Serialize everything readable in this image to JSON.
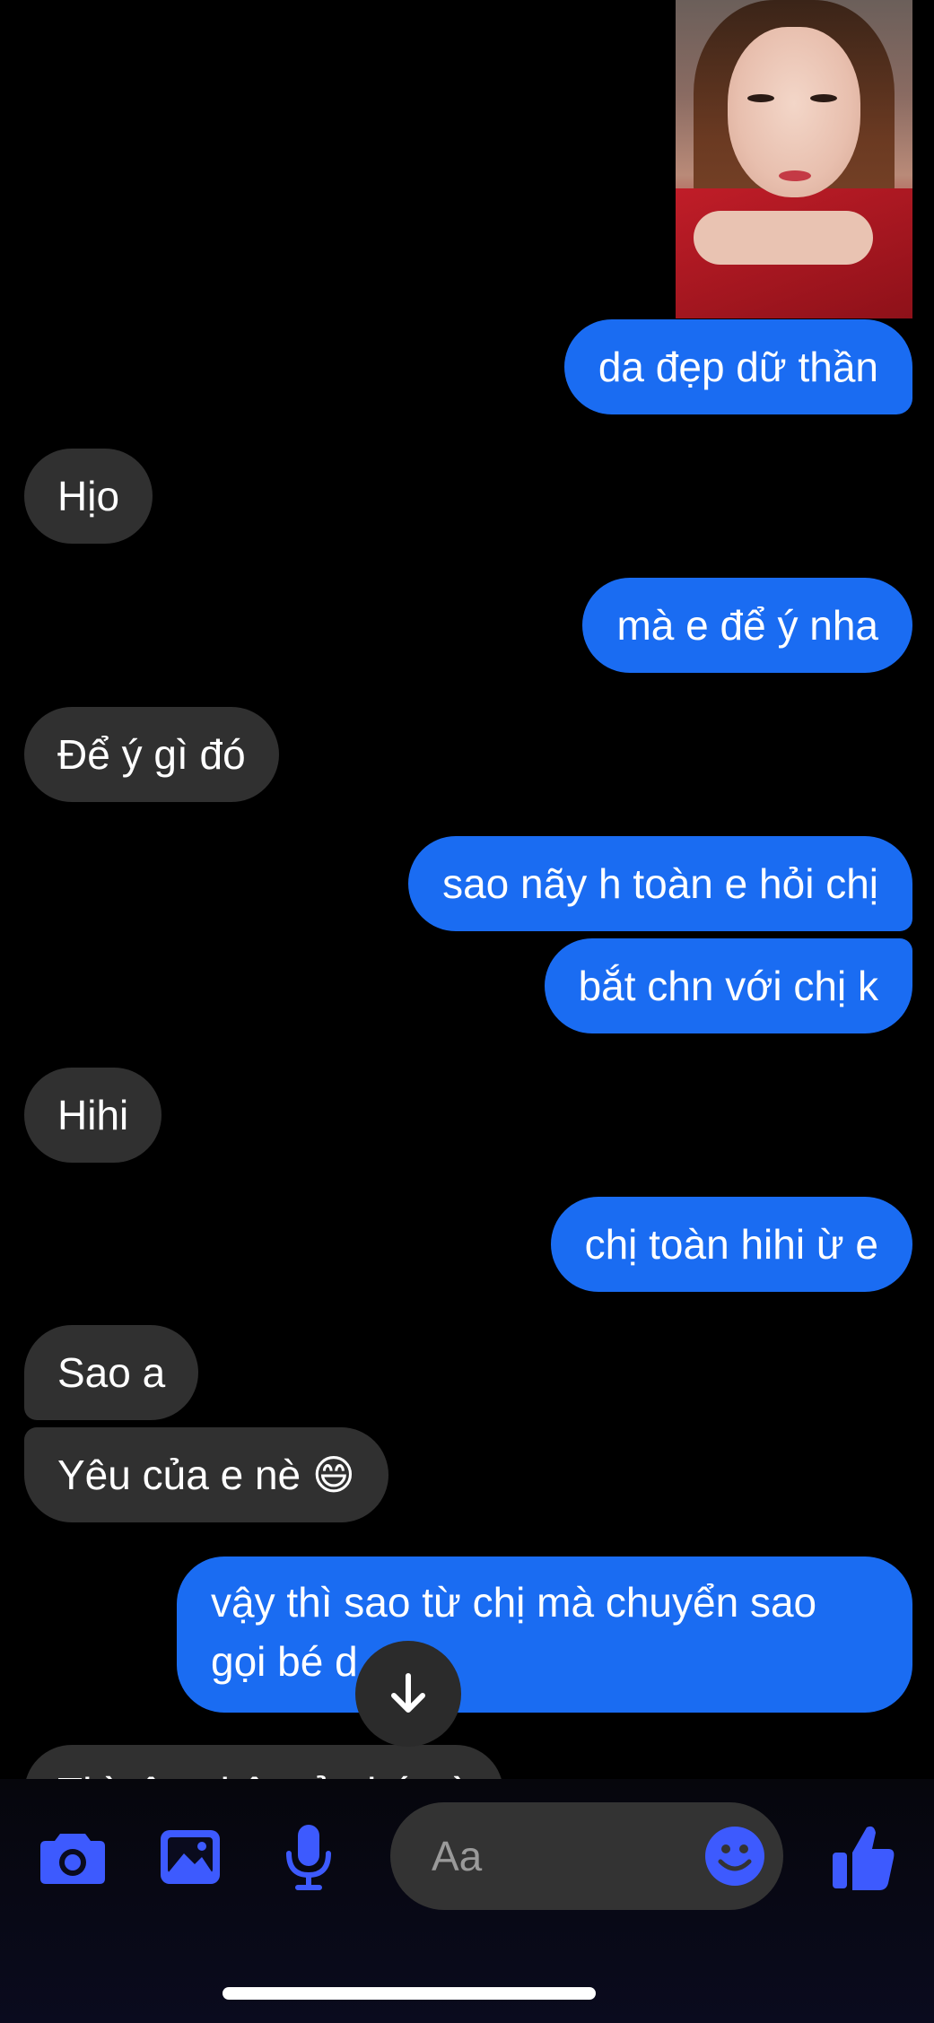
{
  "messages": {
    "out_1": "da đẹp dữ thần",
    "in_1": "Hịo",
    "out_2": "mà e để ý nha",
    "in_2": "Để ý gì đó",
    "out_3": "sao nãy h toàn e hỏi chị",
    "out_4": "bắt chn với chị k",
    "in_3": "Hihi",
    "out_5": "chị toàn hihi ừ e",
    "in_4": "Sao a",
    "in_5": "Yêu của e nè 😄",
    "out_6_line1": "vậy thì sao từ chị mà chuyển sao",
    "out_6_line2": "gọi bé d",
    "in_6_partial": "Thì tâm thật của bé nè"
  },
  "composer": {
    "placeholder": "Aa",
    "icons": [
      "camera-icon",
      "image-icon",
      "microphone-icon",
      "emoji-icon",
      "like-icon"
    ]
  },
  "colors": {
    "outgoing": "#1a6cf2",
    "incoming": "#303030",
    "accent": "#3d5afe"
  }
}
